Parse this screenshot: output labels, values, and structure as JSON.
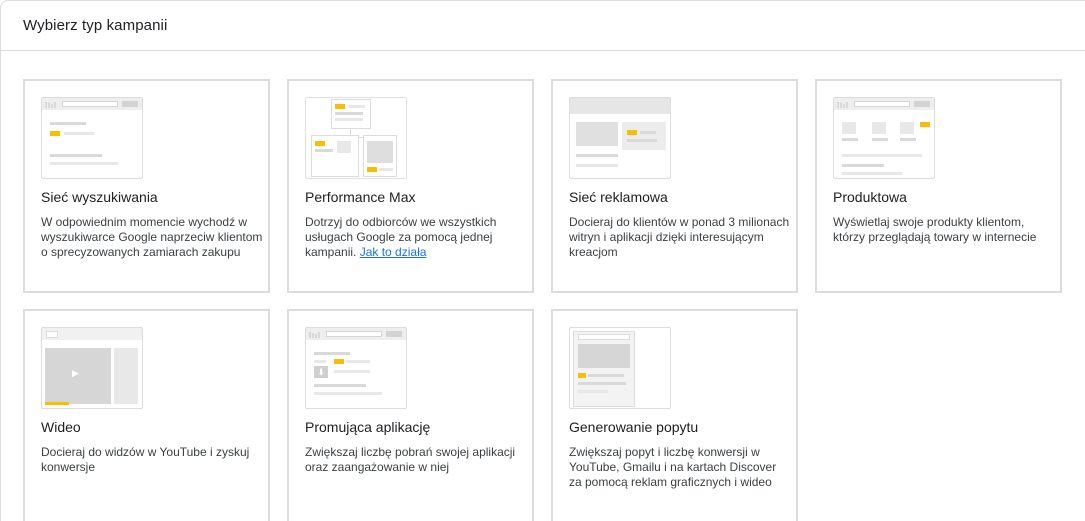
{
  "header": {
    "title": "Wybierz typ kampanii"
  },
  "cards": [
    {
      "title": "Sieć wyszukiwania",
      "desc": "W odpowiednim momencie wychodź w wyszukiwarce Google naprzeciw klientom o sprecyzowanych zamiarach zakupu"
    },
    {
      "title": "Performance Max",
      "desc": "Dotrzyj do odbiorców we wszystkich usługach Google za pomocą jednej kampanii.",
      "link": "Jak to działa"
    },
    {
      "title": "Sieć reklamowa",
      "desc": "Docieraj do klientów w ponad 3 milionach witryn i aplikacji dzięki interesującym kreacjom"
    },
    {
      "title": "Produktowa",
      "desc": "Wyświetlaj swoje produkty klientom, którzy przeglądają towary w internecie"
    },
    {
      "title": "Wideo",
      "desc": "Docieraj do widzów w YouTube i zyskuj konwersje"
    },
    {
      "title": "Promująca aplikację",
      "desc": "Zwiększaj liczbę pobrań swojej aplikacji oraz zaangażowanie w niej"
    },
    {
      "title": "Generowanie popytu",
      "desc": "Zwiększaj popyt i liczbę konwersji w YouTube, Gmailu i na kartach Discover za pomocą reklam graficznych i wideo"
    }
  ],
  "icons": {
    "play": "▶",
    "download": "⬇"
  },
  "colors": {
    "accent": "#fbbc04",
    "link": "#1a73e8",
    "border": "#dadce0"
  }
}
